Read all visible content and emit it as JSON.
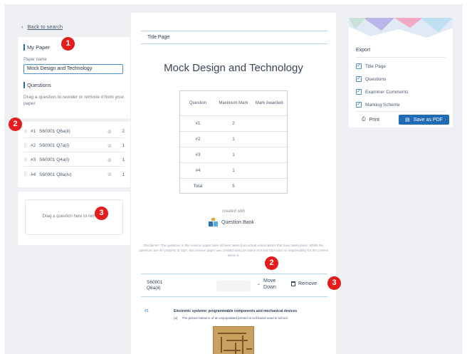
{
  "nav": {
    "back_label": "Back to search"
  },
  "my_paper": {
    "section_title": "My Paper",
    "name_label": "Paper name",
    "name_value": "Mock Design and Technology",
    "questions_title": "Questions",
    "hint": "Drag a question to reorder or remove it from your paper"
  },
  "questions": [
    {
      "num": "#1",
      "code": "S60001 Q6a(ii)",
      "marks": "2"
    },
    {
      "num": "#2",
      "code": "S60001 Q7a(i)",
      "marks": "1"
    },
    {
      "num": "#3",
      "code": "S60001 Q4a(i)",
      "marks": "1"
    },
    {
      "num": "#4",
      "code": "S60001 Q8a(iv)",
      "marks": "1"
    }
  ],
  "dropzone": {
    "text": "Drag a question here to remove it"
  },
  "paper": {
    "header": "Title Page",
    "title": "Mock Design and Technology",
    "table": {
      "headers": [
        "Question",
        "Maximum Mark",
        "Mark Awarded"
      ],
      "rows": [
        {
          "q": "#1",
          "max": "2"
        },
        {
          "q": "#2",
          "max": "1"
        },
        {
          "q": "#3",
          "max": "1"
        },
        {
          "q": "#4",
          "max": "1"
        },
        {
          "q": "Total",
          "max": "5"
        }
      ]
    },
    "created_with": "created with",
    "brand": "Question Bank",
    "disclaimer": "Disclaimer: The questions in this revision paper have all been taken from actual examinations that have taken place. Whilst the questions are the property of SQA, this revision paper was created using an online tool and SQA bear no responsibility for the content within it."
  },
  "question_bar": {
    "code_line1": "S60001",
    "code_line2": "Q6a(ii)",
    "move_line1": "Move",
    "move_line2": "Down",
    "remove": "Remove"
  },
  "question_preview": {
    "num": "#1",
    "heading": "Electronic systems: programmable components and mechanical devices",
    "sub_label": "(a)",
    "sub_text": "The picture below is of an unpopulated printed circuit board used in school."
  },
  "export": {
    "title": "Export",
    "options": [
      {
        "label": "Title Page",
        "checked": true
      },
      {
        "label": "Questions",
        "checked": true
      },
      {
        "label": "Examiner Comments",
        "checked": true
      },
      {
        "label": "Marking Scheme",
        "checked": true
      }
    ],
    "print_label": "Print",
    "pdf_label": "Save as PDF"
  },
  "annotations": [
    "1",
    "2",
    "3",
    "2",
    "3"
  ],
  "colors": {
    "accent": "#1f6cb5",
    "badge": "#e51c1c",
    "background": "#eef0f3"
  },
  "icons": [
    "chevron-left-icon",
    "grip-icon",
    "paperclip-icon",
    "chevron-down-icon",
    "trash-icon",
    "printer-icon",
    "pdf-icon",
    "check-icon",
    "question-bank-logo"
  ]
}
